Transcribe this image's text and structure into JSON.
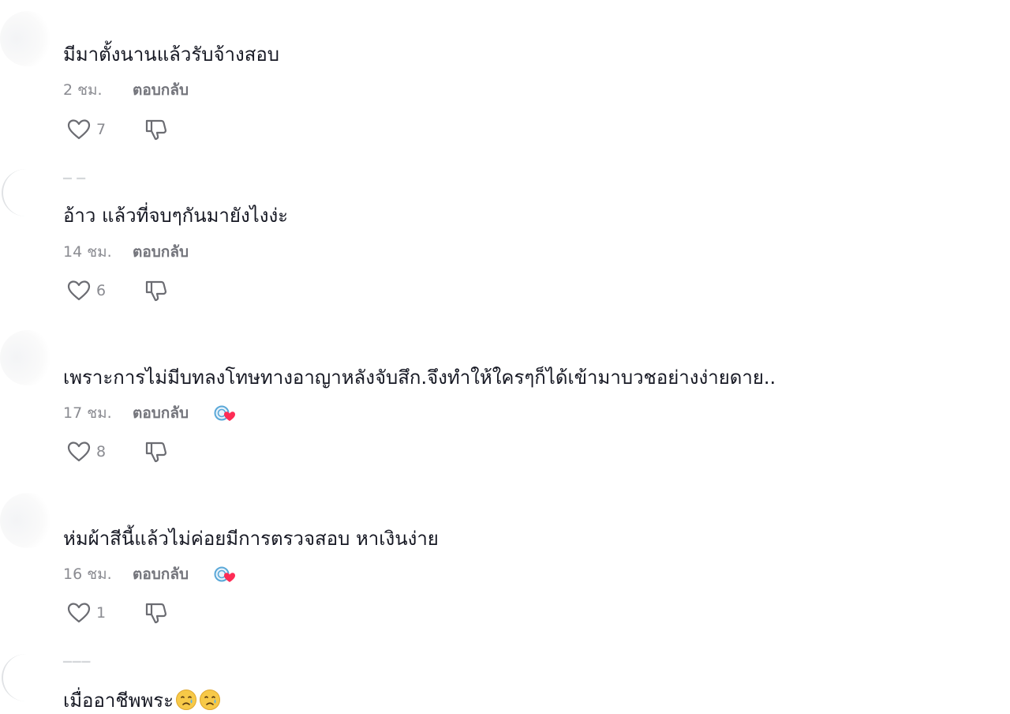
{
  "comments": [
    {
      "text": "มีมาตั้งนานแล้วรับจ้างสอบ",
      "time": "2 ชม.",
      "reply_label": "ตอบกลับ",
      "likes": "7",
      "creator_liked": false
    },
    {
      "text": "อ้าว แล้วที่จบๆกันมายังไงง่ะ",
      "time": "14 ชม.",
      "reply_label": "ตอบกลับ",
      "likes": "6",
      "creator_liked": false
    },
    {
      "text": "เพราะการไม่มีบทลงโทษทางอาญาหลังจับสึก.จึงทำให้ใครๆก็ได้เข้ามาบวชอย่างง่ายดาย..",
      "time": "17 ชม.",
      "reply_label": "ตอบกลับ",
      "likes": "8",
      "creator_liked": true
    },
    {
      "text": "ห่มผ้าสีนี้แล้วไม่ค่อยมีการตรวจสอบ หาเงินง่าย",
      "time": "16 ชม.",
      "reply_label": "ตอบกลับ",
      "likes": "1",
      "creator_liked": true
    },
    {
      "text": "เมื่ออาชีพพระ",
      "emoji": [
        "crying-face",
        "crying-face"
      ]
    }
  ],
  "icons": {
    "like": "heart-outline-icon",
    "dislike": "thumbs-down-outline-icon",
    "creator_like": "creator-liked-heart-icon"
  },
  "colors": {
    "text": "#161823",
    "meta": "#8a8b91",
    "heart_badge": "#fe2c55"
  }
}
